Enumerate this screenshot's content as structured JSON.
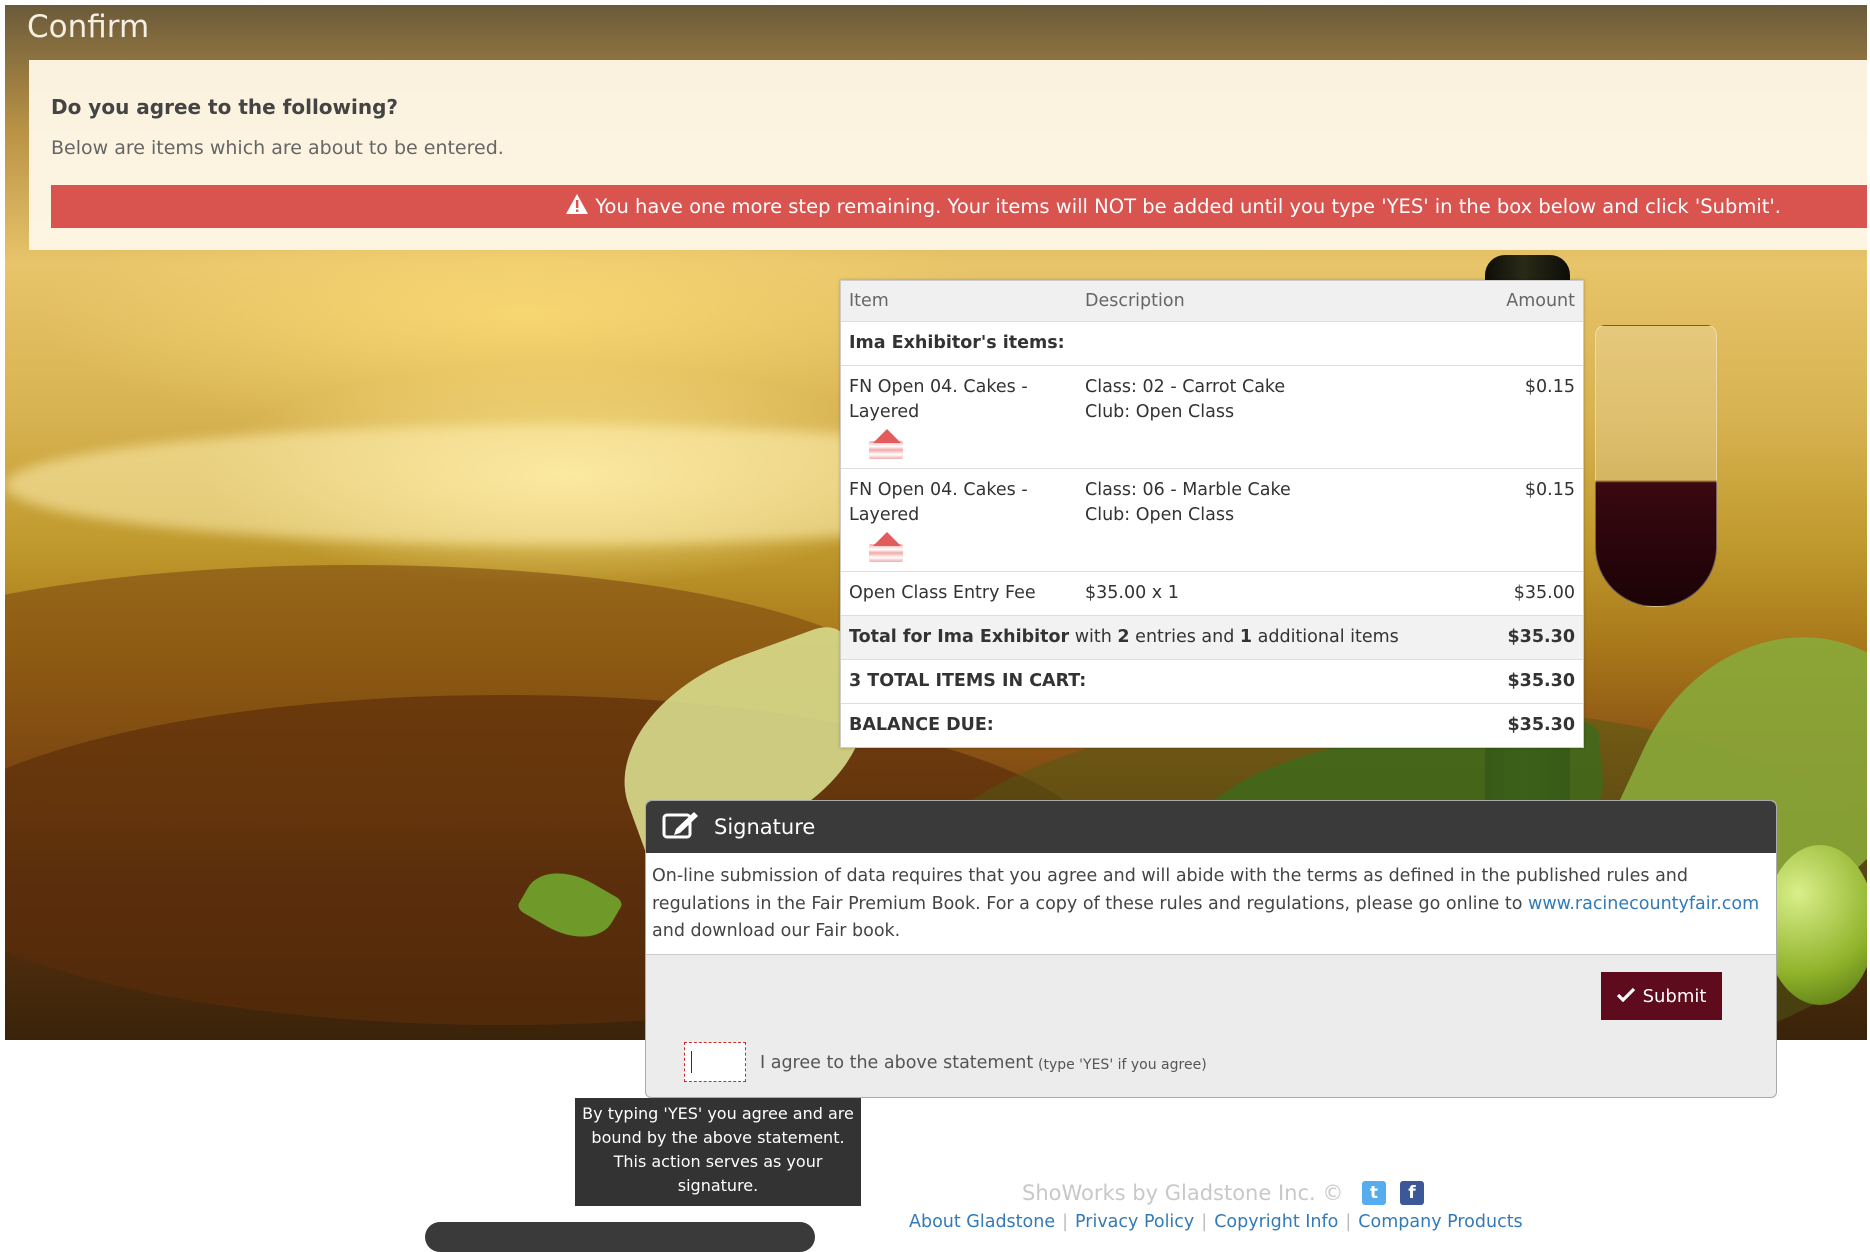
{
  "page": {
    "title": "Confirm",
    "question": "Do you agree to the following?",
    "subtitle": "Below are items which are about to be entered.",
    "alert": "You have one more step remaining. Your items will NOT be added until you type 'YES' in the box below and click 'Submit'."
  },
  "cart": {
    "headers": {
      "item": "Item",
      "description": "Description",
      "amount": "Amount"
    },
    "group_label": "Ima Exhibitor's items:",
    "rows": [
      {
        "item": "FN Open 04. Cakes - Layered",
        "class": "Class: 02 - Carrot Cake",
        "club": "Club: Open Class",
        "amount": "$0.15",
        "icon": "cake-icon"
      },
      {
        "item": "FN Open 04. Cakes - Layered",
        "class": "Class: 06 - Marble Cake",
        "club": "Club: Open Class",
        "amount": "$0.15",
        "icon": "cake-icon"
      }
    ],
    "fee": {
      "item": "Open Class Entry Fee",
      "description": "$35.00 x 1",
      "amount": "$35.00"
    },
    "total": {
      "prefix": "Total for Ima Exhibitor",
      "with": " with ",
      "entries": "2",
      "entries_text": " entries and ",
      "additional": "1",
      "additional_text": " additional items",
      "amount": "$35.30"
    },
    "cart_total": {
      "label": "3 TOTAL ITEMS IN CART:",
      "amount": "$35.30"
    },
    "balance": {
      "label": "BALANCE DUE:",
      "amount": "$35.30"
    }
  },
  "signature": {
    "title": "Signature",
    "text_before": "On-line submission of data requires that you agree and will abide with the terms as defined in the published rules and regulations in the Fair Premium Book.  For a copy of these rules and regulations, please go online to ",
    "link": "www.racinecountyfair.com",
    "text_after": " and download our Fair book.",
    "submit_label": "Submit",
    "input_value": "",
    "agree_label": "I agree to the above statement",
    "agree_hint": "(type 'YES' if you agree)",
    "tooltip": "By typing 'YES' you agree and are bound by the above statement. This action serves as your signature."
  },
  "footer": {
    "brand": "ShoWorks by Gladstone Inc. ©",
    "links": [
      "About Gladstone",
      "Privacy Policy",
      "Copyright Info",
      "Company Products"
    ],
    "social": [
      "twitter-icon",
      "facebook-icon"
    ]
  },
  "colors": {
    "alert": "#d9534f",
    "submit": "#5e0b1e",
    "header_dark": "#3a3a3a",
    "link": "#337ab7"
  }
}
